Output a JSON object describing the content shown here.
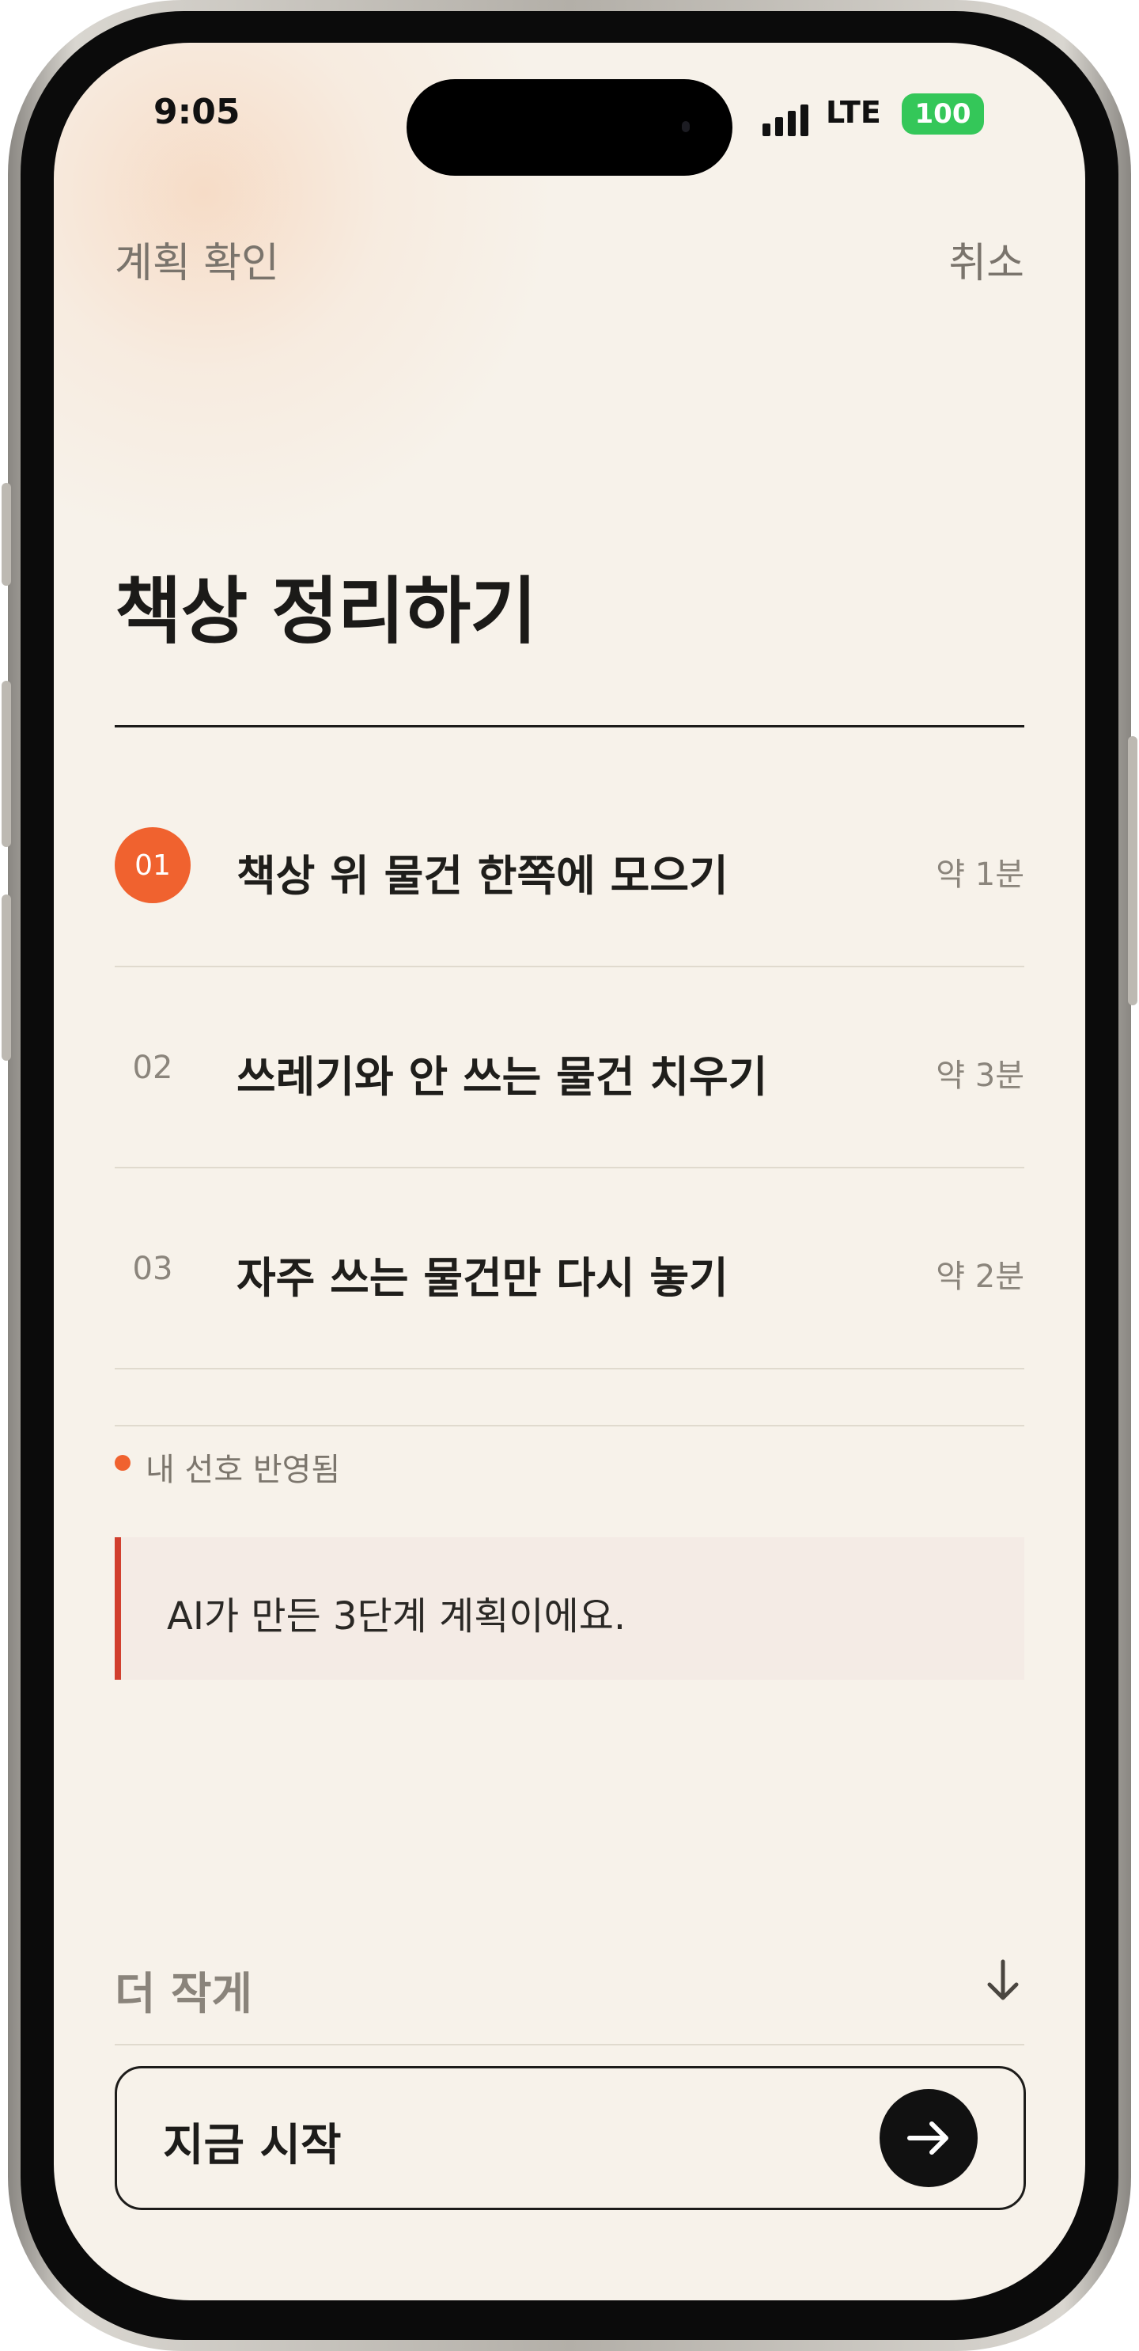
{
  "status": {
    "time": "9:05",
    "network": "LTE",
    "battery": "100"
  },
  "nav": {
    "title": "계획 확인",
    "cancel": "취소"
  },
  "headline": "책상 정리하기",
  "steps": [
    {
      "num": "01",
      "label": "책상 위 물건 한쪽에 모으기",
      "time": "약 1분",
      "active": true
    },
    {
      "num": "02",
      "label": "쓰레기와 안 쓰는 물건 치우기",
      "time": "약 3분",
      "active": false
    },
    {
      "num": "03",
      "label": "자주 쓰는 물건만 다시 놓기",
      "time": "약 2분",
      "active": false
    }
  ],
  "preference": "내 선호 반영됨",
  "ai_note": "AI가 만든 3단계 계획이에요.",
  "smaller_option": "더 작게",
  "start_button": "지금 시작",
  "colors": {
    "accent": "#f0622f",
    "note_bar": "#d13f2e",
    "battery": "#34c759",
    "background": "#f7f2ea"
  },
  "icons": {
    "smaller": "arrow-down-icon",
    "start": "arrow-right-icon"
  }
}
